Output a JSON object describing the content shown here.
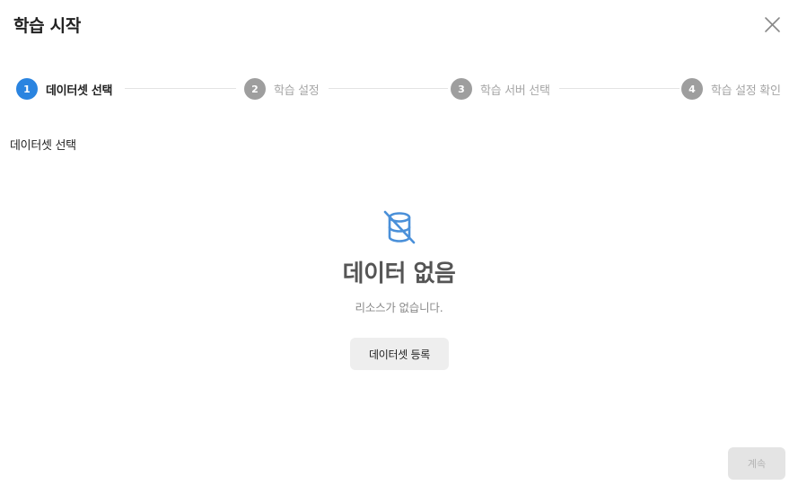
{
  "dialog": {
    "title": "학습 시작",
    "close_icon": "close-icon"
  },
  "steps": [
    {
      "number": "1",
      "label": "데이터셋 선택",
      "active": true
    },
    {
      "number": "2",
      "label": "학습 설정",
      "active": false
    },
    {
      "number": "3",
      "label": "학습 서버 선택",
      "active": false
    },
    {
      "number": "4",
      "label": "학습 설정 확인",
      "active": false
    }
  ],
  "section": {
    "label": "데이터셋 선택"
  },
  "empty_state": {
    "icon": "database-off-icon",
    "title": "데이터 없음",
    "description": "리소스가 없습니다.",
    "register_label": "데이터셋 등록"
  },
  "footer": {
    "continue_label": "계속"
  },
  "colors": {
    "accent": "#2a84e0",
    "inactive_step": "#9e9e9e",
    "icon": "#4a90d9"
  }
}
